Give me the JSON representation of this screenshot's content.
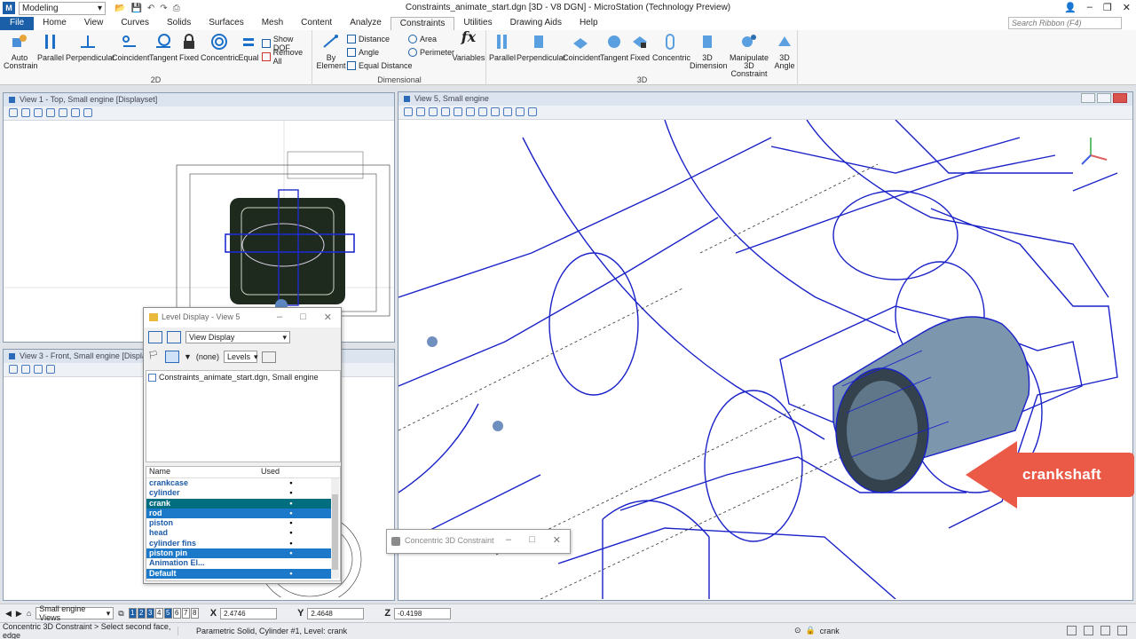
{
  "app": {
    "workflow": "Modeling",
    "title": "Constraints_animate_start.dgn [3D - V8 DGN] - MicroStation (Technology Preview)"
  },
  "tabs": [
    "File",
    "Home",
    "View",
    "Curves",
    "Solids",
    "Surfaces",
    "Mesh",
    "Content",
    "Analyze",
    "Constraints",
    "Utilities",
    "Drawing Aids",
    "Help"
  ],
  "active_tab": "Constraints",
  "search_placeholder": "Search Ribbon (F4)",
  "ribbon": {
    "group_2d": {
      "label": "2D",
      "auto_constrain": "Auto Constrain",
      "parallel": "Parallel",
      "perpendicular": "Perpendicular",
      "coincident": "Coincident",
      "tangent": "Tangent",
      "fixed": "Fixed",
      "concentric": "Concentric",
      "equal": "Equal",
      "show_dof": "Show DOF",
      "remove_all": "Remove All"
    },
    "group_dim": {
      "label": "Dimensional",
      "by_element": "By Element",
      "distance": "Distance",
      "angle": "Angle",
      "equal_distance": "Equal Distance",
      "area": "Area",
      "perimeter": "Perimeter",
      "variables": "Variables"
    },
    "group_3d": {
      "label": "3D",
      "parallel": "Parallel",
      "perpendicular": "Perpendicular",
      "coincident": "Coincident",
      "tangent": "Tangent",
      "fixed": "Fixed",
      "concentric": "Concentric",
      "dimension": "3D Dimension",
      "manipulate": "Manipulate 3D Constraint",
      "angle": "3D Angle"
    }
  },
  "views": {
    "view1": "View 1 - Top, Small engine [Displayset]",
    "view3": "View 3 - Front, Small engine [Displayset]",
    "view5": "View 5, Small engine"
  },
  "level_dialog": {
    "title": "Level Display - View 5",
    "mode": "View Display",
    "filter": "(none)",
    "levels_btn": "Levels",
    "file": "Constraints_animate_start.dgn, Small engine",
    "col_name": "Name",
    "col_used": "Used",
    "rows": [
      {
        "name": "crankcase",
        "used": "•"
      },
      {
        "name": "cylinder",
        "used": "•"
      },
      {
        "name": "crank",
        "used": "•"
      },
      {
        "name": "rod",
        "used": "•"
      },
      {
        "name": "piston",
        "used": "•"
      },
      {
        "name": "head",
        "used": "•"
      },
      {
        "name": "cylinder fins",
        "used": "•"
      },
      {
        "name": "piston pin",
        "used": "•"
      },
      {
        "name": "Animation El...",
        "used": ""
      },
      {
        "name": "Default",
        "used": "•"
      }
    ]
  },
  "concentric_dialog": {
    "title": "Concentric 3D Constraint"
  },
  "callout": {
    "text": "crankshaft"
  },
  "bottom": {
    "views_label": "Small engine Views",
    "view_numbers": [
      "1",
      "2",
      "3",
      "4",
      "5",
      "6",
      "7",
      "8"
    ],
    "x_label": "X",
    "x_value": "2.4746",
    "y_label": "Y",
    "y_value": "2.4648",
    "z_label": "Z",
    "z_value": "-0.4198"
  },
  "status": {
    "prompt": "Concentric 3D Constraint > Select second face, edge",
    "info": "Parametric Solid, Cylinder #1, Level: crank",
    "level": "crank"
  }
}
